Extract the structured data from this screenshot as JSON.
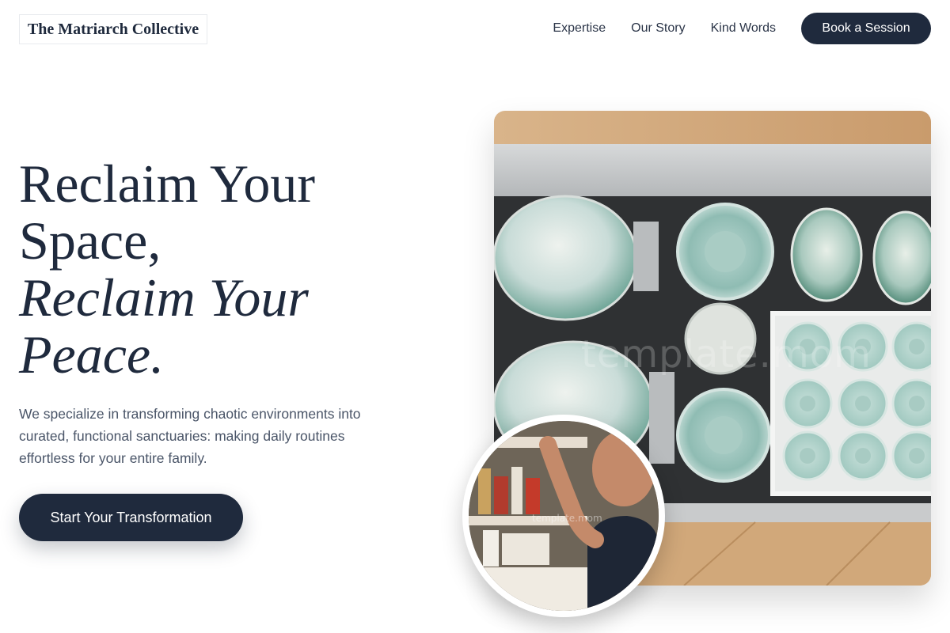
{
  "header": {
    "logo_text": "The Matriarch Collective",
    "nav": [
      {
        "label": "Expertise"
      },
      {
        "label": "Our Story"
      },
      {
        "label": "Kind Words"
      }
    ],
    "book_button_label": "Book a Session"
  },
  "hero": {
    "title_line1": "Reclaim Your",
    "title_line2": "Space,",
    "title_line3": "Reclaim Your",
    "title_line4": "Peace.",
    "description": "We specialize in transforming chaotic environments into curated, functional sanctuaries: making daily routines effortless for your entire family.",
    "cta_label": "Start Your Transformation"
  },
  "images": {
    "main_watermark": "template.mom",
    "circle_watermark": "template.mom"
  },
  "colors": {
    "primary": "#1f2a3d",
    "text_muted": "#4a5568",
    "background": "#ffffff"
  }
}
